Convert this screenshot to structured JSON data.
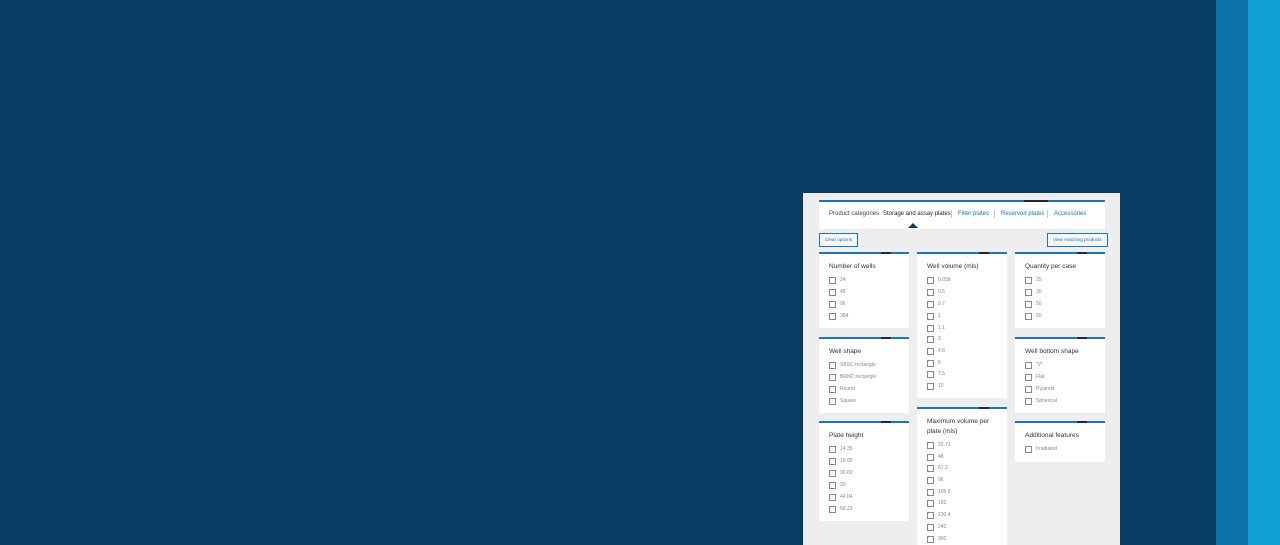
{
  "tabs": {
    "label": "Product categories",
    "active": "Storage and assay plates",
    "items": [
      "Filter plates",
      "Reservoir plates",
      "Accessories"
    ]
  },
  "buttons": {
    "clear": "Clear options",
    "view": "View matching products"
  },
  "filters": {
    "number_of_wells": {
      "title": "Number of wells",
      "options": [
        "24",
        "48",
        "96",
        "384"
      ]
    },
    "well_volume": {
      "title": "Well volume (mls)",
      "options": [
        "0.058",
        "0.5",
        "0.7",
        "1",
        "1.1",
        "2",
        "4.8",
        "5",
        "7.5",
        "10"
      ]
    },
    "quantity_per_case": {
      "title": "Quantity per case",
      "options": [
        "25",
        "30",
        "50",
        "60"
      ]
    },
    "well_shape": {
      "title": "Well shape",
      "options": [
        "SBSC rectangle",
        "BRNC rectangle",
        "Round",
        "Square"
      ]
    },
    "well_bottom_shape": {
      "title": "Well bottom shape",
      "options": [
        "\"V\"",
        "Flat",
        "Pyramid",
        "Spherical"
      ]
    },
    "plate_height": {
      "title": "Plate height",
      "options": [
        "14.35",
        "19.05",
        "30.60",
        "32",
        "44.04",
        "58.33"
      ]
    },
    "max_volume_per_plate": {
      "title": "Maximum volume per plate (mls)",
      "options": [
        "22.72",
        "48",
        "67.2",
        "96",
        "105.6",
        "192",
        "230.4",
        "240",
        "360"
      ]
    },
    "additional_features": {
      "title": "Additional features",
      "options": [
        "Irradiated"
      ]
    }
  },
  "colors": {
    "background": "#073d65",
    "accent": "#1b75b8",
    "stripe_dark": "#0a72a6",
    "stripe_light": "#11a0d6"
  }
}
